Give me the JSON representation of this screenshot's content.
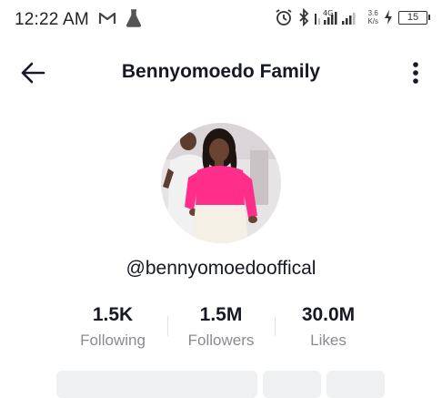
{
  "status_bar": {
    "time": "12:22 AM",
    "icons": [
      "gmail-icon",
      "flask-icon",
      "alarm-icon",
      "bluetooth-icon",
      "signal-icon"
    ],
    "network_type": "4G",
    "net_speed_value": "3.6",
    "net_speed_unit": "K/s",
    "battery_level": "15"
  },
  "header": {
    "title": "Bennyomoedo Family"
  },
  "profile": {
    "username": "@bennyomoedooffical"
  },
  "stats": [
    {
      "value": "1.5K",
      "label": "Following"
    },
    {
      "value": "1.5M",
      "label": "Followers"
    },
    {
      "value": "30.0M",
      "label": "Likes"
    }
  ],
  "colors": {
    "text_primary": "#161823",
    "text_secondary": "#8a8b91",
    "button_bg": "#eef0f1",
    "outfit_pink": "#ff2e8a"
  }
}
